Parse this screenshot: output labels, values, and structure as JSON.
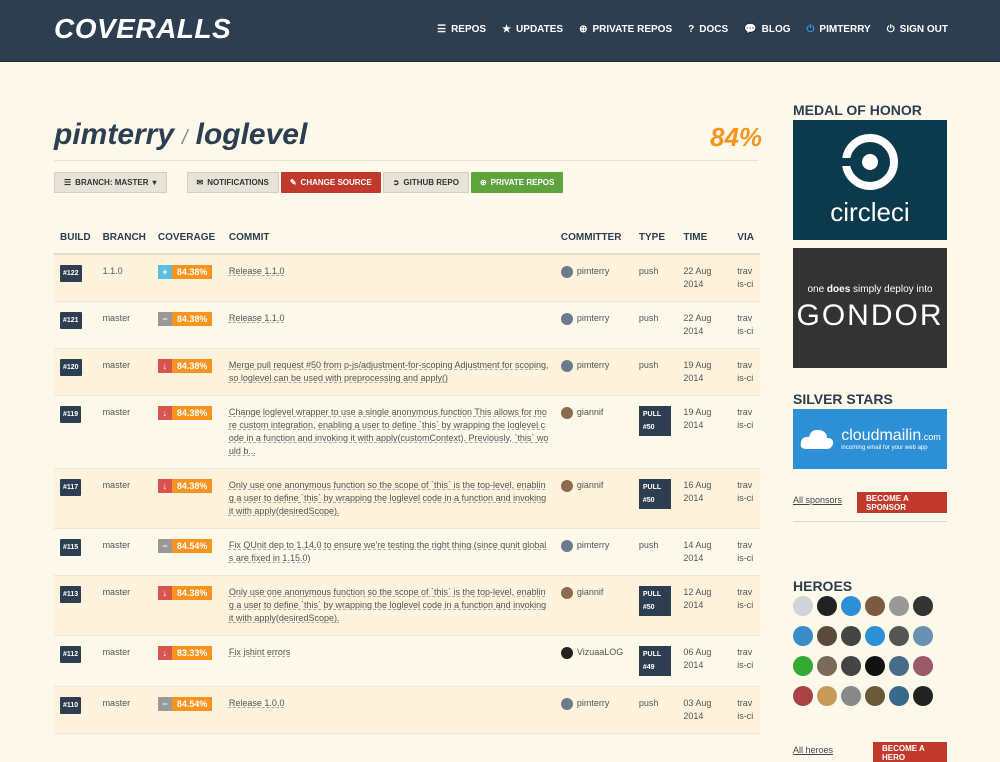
{
  "app": {
    "logo": "COVERALLS"
  },
  "nav": [
    {
      "icon": "list-icon",
      "glyph": "☰",
      "label": "REPOS"
    },
    {
      "icon": "star-icon",
      "glyph": "★",
      "label": "UPDATES"
    },
    {
      "icon": "plus-circle-icon",
      "glyph": "⊕",
      "label": "PRIVATE REPOS"
    },
    {
      "icon": "question-icon",
      "glyph": "?",
      "label": "DOCS"
    },
    {
      "icon": "chat-icon",
      "glyph": "💬",
      "label": "BLOG"
    },
    {
      "icon": "power-icon",
      "glyph": "⏻",
      "label": "PIMTERRY"
    },
    {
      "icon": "power-icon",
      "glyph": "⏻",
      "label": "SIGN OUT"
    }
  ],
  "repo": {
    "owner": "pimterry",
    "separator": "/",
    "name": "loglevel",
    "coverage": "84%"
  },
  "buttons": {
    "branch": "BRANCH: MASTER",
    "notifications": "NOTIFICATIONS",
    "change_source": "CHANGE SOURCE",
    "github_repo": "GITHUB REPO",
    "private_repos": "PRIVATE REPOS"
  },
  "table": {
    "headers": [
      "BUILD",
      "BRANCH",
      "COVERAGE",
      "COMMIT",
      "COMMITTER",
      "TYPE",
      "TIME",
      "VIA"
    ],
    "rows": [
      {
        "build": "#122",
        "branch": "1.1.0",
        "trend": "up",
        "coverage": "84.38%",
        "commit": "Release 1.1.0",
        "committer": "pimterry",
        "type": "push",
        "time": "22 Aug 2014",
        "via": "travis-ci"
      },
      {
        "build": "#121",
        "branch": "master",
        "trend": "same",
        "coverage": "84.38%",
        "commit": "Release 1.1.0",
        "committer": "pimterry",
        "type": "push",
        "time": "22 Aug 2014",
        "via": "travis-ci"
      },
      {
        "build": "#120",
        "branch": "master",
        "trend": "down",
        "coverage": "84.38%",
        "commit": "Merge pull request #50 from p-js/adjustment-for-scoping Adjustment for scoping, so loglevel can be used with preprocessing and apply()",
        "committer": "pimterry",
        "type": "push",
        "time": "19 Aug 2014",
        "via": "travis-ci"
      },
      {
        "build": "#119",
        "branch": "master",
        "trend": "down",
        "coverage": "84.38%",
        "commit": "Change loglevel wrapper to use a single anonymous function This allows for more custom integration, enabling a user to define `this` by wrapping the loglevel code in a function and invoking it with apply(customContext). Previously, `this` would b...",
        "committer": "giannif",
        "type": "PULL #50",
        "time": "19 Aug 2014",
        "via": "travis-ci"
      },
      {
        "build": "#117",
        "branch": "master",
        "trend": "down",
        "coverage": "84.38%",
        "commit": "Only use one anonymous function so the scope of `this` is the top-level, enabling a user to define `this` by wrapping the loglevel code in a function and invoking it with apply(desiredScope).",
        "committer": "giannif",
        "type": "PULL #50",
        "time": "16 Aug 2014",
        "via": "travis-ci"
      },
      {
        "build": "#115",
        "branch": "master",
        "trend": "same",
        "coverage": "84.54%",
        "commit": "Fix QUnit dep to 1.14.0 to ensure we're testing the right thing (since qunit globals are fixed in 1.15.0)",
        "committer": "pimterry",
        "type": "push",
        "time": "14 Aug 2014",
        "via": "travis-ci"
      },
      {
        "build": "#113",
        "branch": "master",
        "trend": "down",
        "coverage": "84.38%",
        "commit": "Only use one anonymous function so the scope of `this` is the top-level, enabling a user to define `this` by wrapping the loglevel code in a function and invoking it with apply(desiredScope).",
        "committer": "giannif",
        "type": "PULL #50",
        "time": "12 Aug 2014",
        "via": "travis-ci"
      },
      {
        "build": "#112",
        "branch": "master",
        "trend": "down",
        "coverage": "83.33%",
        "commit": "Fix jshint errors",
        "committer": "VizuaaLOG",
        "type": "PULL #49",
        "time": "06 Aug 2014",
        "via": "travis-ci"
      },
      {
        "build": "#110",
        "branch": "master",
        "trend": "same",
        "coverage": "84.54%",
        "commit": "Release 1.0.0",
        "committer": "pimterry",
        "type": "push",
        "time": "03 Aug 2014",
        "via": "travis-ci"
      }
    ]
  },
  "sidebar": {
    "medal_title": "MEDAL OF HONOR",
    "circleci_text": "circleci",
    "gondor_tagline_a": "one",
    "gondor_tagline_b": "does",
    "gondor_tagline_c": "simply deploy into",
    "gondor_name": "GONDOR",
    "silver_title": "SILVER STARS",
    "cloudmailin_name": "cloudmailin",
    "cloudmailin_tld": ".com",
    "cloudmailin_tagline": "incoming email for your web app",
    "all_sponsors": "All sponsors",
    "become_sponsor": "BECOME A SPONSOR",
    "heroes_title": "HEROES",
    "all_heroes": "All heroes",
    "become_hero": "BECOME A HERO",
    "colors": {
      "accent_orange": "#f7941d",
      "navy": "#2c3e50",
      "red": "#c0392b",
      "green": "#5fa33f"
    }
  }
}
